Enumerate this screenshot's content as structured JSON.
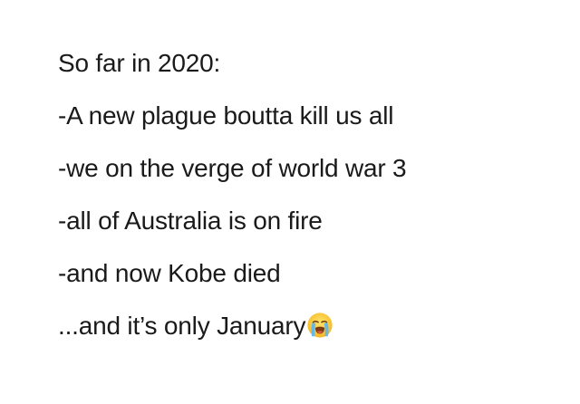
{
  "post": {
    "lines": [
      "So far in 2020:",
      "-A new plague boutta kill us all",
      "-we on the verge of world war 3",
      "-all of Australia is on fire",
      "-and now Kobe died",
      "...and it’s only January"
    ],
    "emoji": "loudly-crying-face-icon"
  }
}
